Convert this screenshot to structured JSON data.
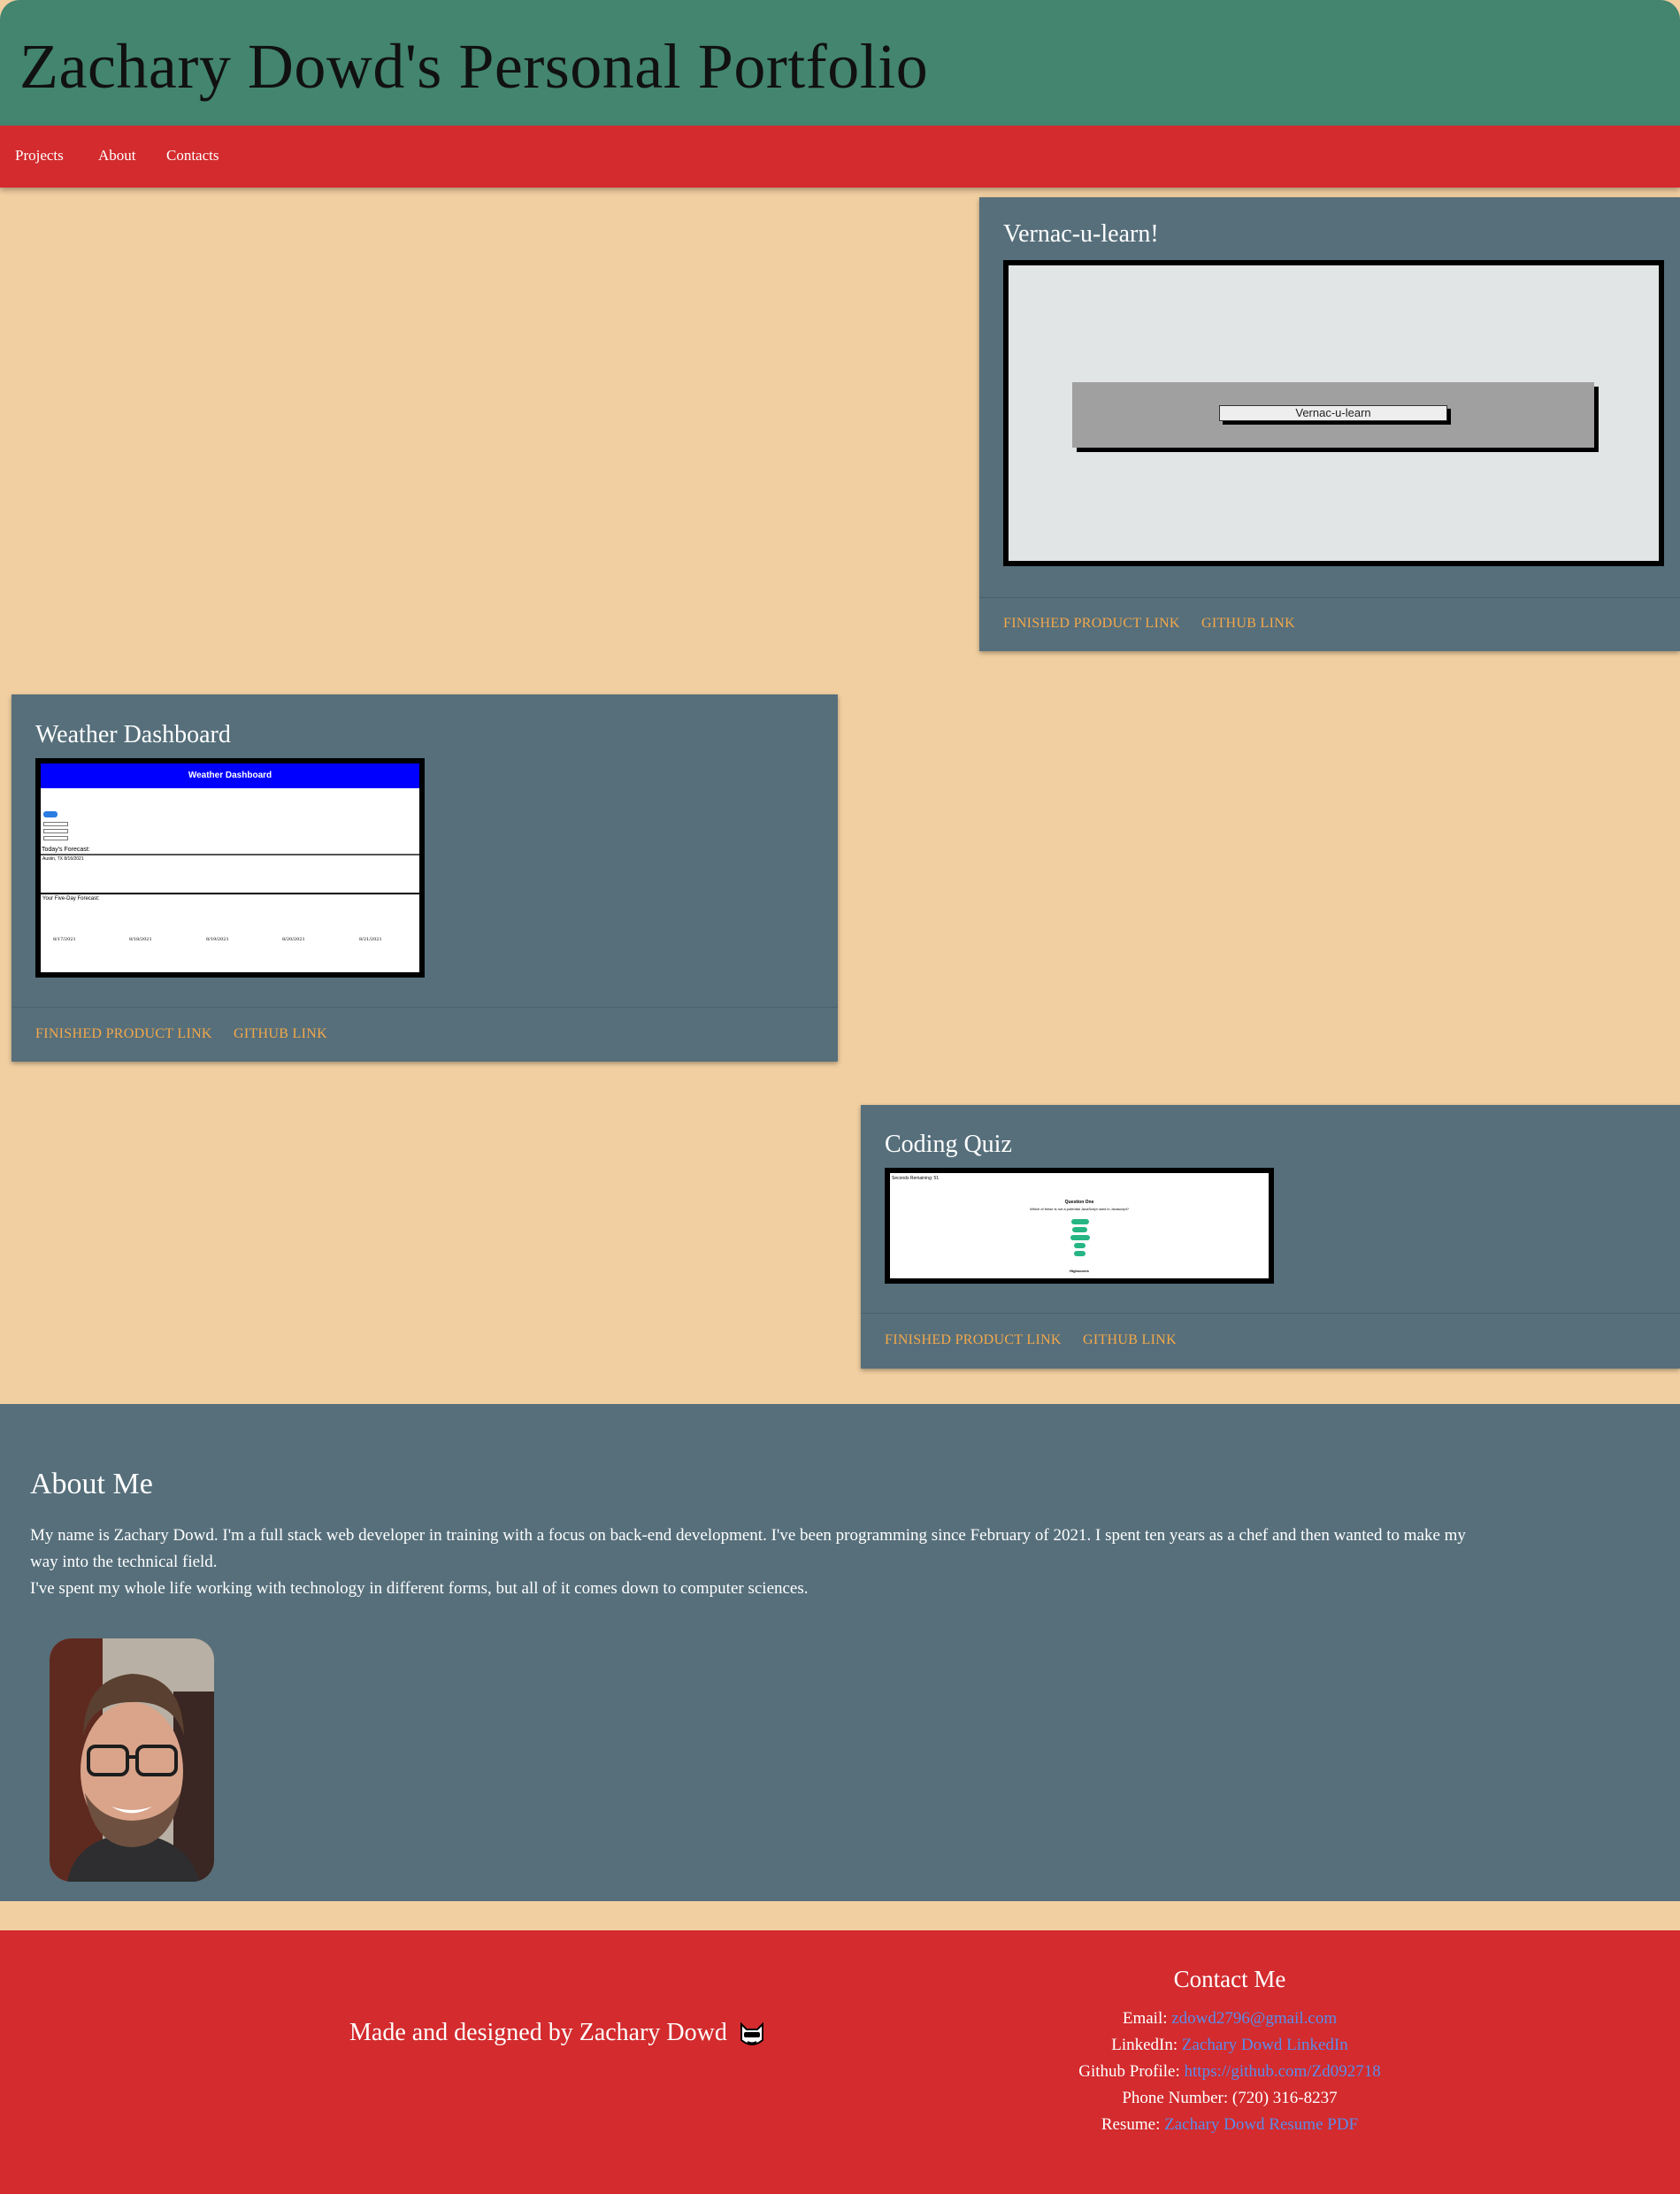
{
  "header": {
    "title": "Zachary Dowd's Personal Portfolio"
  },
  "nav": {
    "items": [
      "Projects",
      "About",
      "Contacts"
    ]
  },
  "projects": [
    {
      "title": "Vernac-u-learn!",
      "screenshot_label": "Vernac-u-learn",
      "links": [
        "FINISHED PRODUCT LINK",
        "GITHUB LINK"
      ]
    },
    {
      "title": "Weather Dashboard",
      "screenshot": {
        "header": "Weather Dashboard",
        "today_heading": "Today's Forecast:",
        "today_city": "Austin, TX 8/16/2021",
        "forecast_heading": "Your Five-Day Forecast:",
        "days": [
          "8/17/2021",
          "8/18/2021",
          "8/19/2021",
          "8/20/2021",
          "8/21/2021"
        ]
      },
      "links": [
        "FINISHED PRODUCT LINK",
        "GITHUB LINK"
      ]
    },
    {
      "title": "Coding Quiz",
      "screenshot": {
        "timer": "Seconds Remaining: 51",
        "question_heading": "Question One",
        "question": "Which of these is not a potential JavaScript used in Javascript?",
        "footer": "Highscores"
      },
      "links": [
        "FINISHED PRODUCT LINK",
        "GITHUB LINK"
      ]
    }
  ],
  "about": {
    "heading": "About Me",
    "paragraph1_line1": "My name is Zachary Dowd. I'm a full stack web developer in training with a focus on back-end development. I've been programming since February of 2021. I spent ten years as a chef and then wanted to make my",
    "paragraph1_line2": "way into the technical field.",
    "paragraph2": "I've spent my whole life working with technology in different forms, but all of it comes down to computer sciences."
  },
  "footer": {
    "made_by": "Made and designed by Zachary Dowd",
    "contact_heading": "Contact Me",
    "contacts": [
      {
        "label": "Email:",
        "value": "zdowd2796@gmail.com"
      },
      {
        "label": "LinkedIn:",
        "value": "Zachary Dowd LinkedIn"
      },
      {
        "label": "Github Profile:",
        "value": "https://github.com/Zd092718"
      },
      {
        "label": "Phone Number:",
        "value": "(720) 316-8237"
      },
      {
        "label": "Resume:",
        "value": "Zachary Dowd Resume PDF"
      }
    ]
  },
  "colors": {
    "page_bg": "#f1cfa1",
    "header_bg": "#43856f",
    "nav_bg": "#d32b2e",
    "card_bg": "#566f7b",
    "link": "#f4a84a",
    "footer_link": "#5b8de8"
  }
}
